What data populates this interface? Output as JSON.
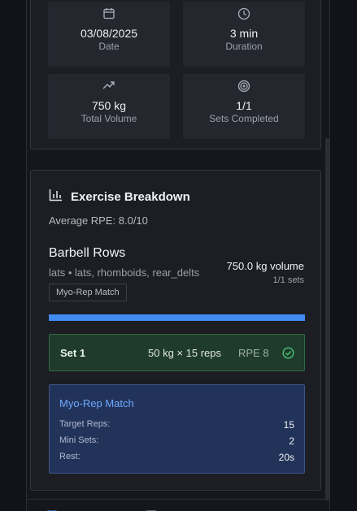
{
  "summary": {
    "date": {
      "icon": "calendar-icon",
      "value": "03/08/2025",
      "label": "Date"
    },
    "duration": {
      "icon": "clock-icon",
      "value": "3 min",
      "label": "Duration"
    },
    "volume": {
      "icon": "trending-up-icon",
      "value": "750 kg",
      "label": "Total Volume"
    },
    "sets": {
      "icon": "target-icon",
      "value": "1/1",
      "label": "Sets Completed"
    }
  },
  "breakdown": {
    "icon": "bar-chart-icon",
    "title": "Exercise Breakdown",
    "average_rpe": "Average RPE: 8.0/10",
    "exercise": {
      "name": "Barbell Rows",
      "muscles": "lats • lats, rhomboids, rear_delts",
      "volume": "750.0 kg volume",
      "sets": "1/1 sets",
      "tag": "Myo-Rep Match",
      "progress": 1.0
    },
    "set": {
      "label": "Set 1",
      "detail": "50 kg × 15 reps",
      "rpe": "RPE 8",
      "icon": "check-circle-icon"
    },
    "myo": {
      "title": "Myo-Rep Match",
      "rows": [
        {
          "key": "Target Reps:",
          "value": "15"
        },
        {
          "key": "Mini Sets:",
          "value": "2"
        },
        {
          "key": "Rest:",
          "value": "20s"
        }
      ]
    }
  },
  "bottom_nav": [
    "dumbbell-icon",
    "gear-icon",
    "document-icon",
    "target-icon",
    "minus-icon",
    "chevron-up-icon"
  ],
  "colors": {
    "accent": "#3f8bf0",
    "success": "#2f6b45",
    "myo_bg": "#22335a"
  }
}
